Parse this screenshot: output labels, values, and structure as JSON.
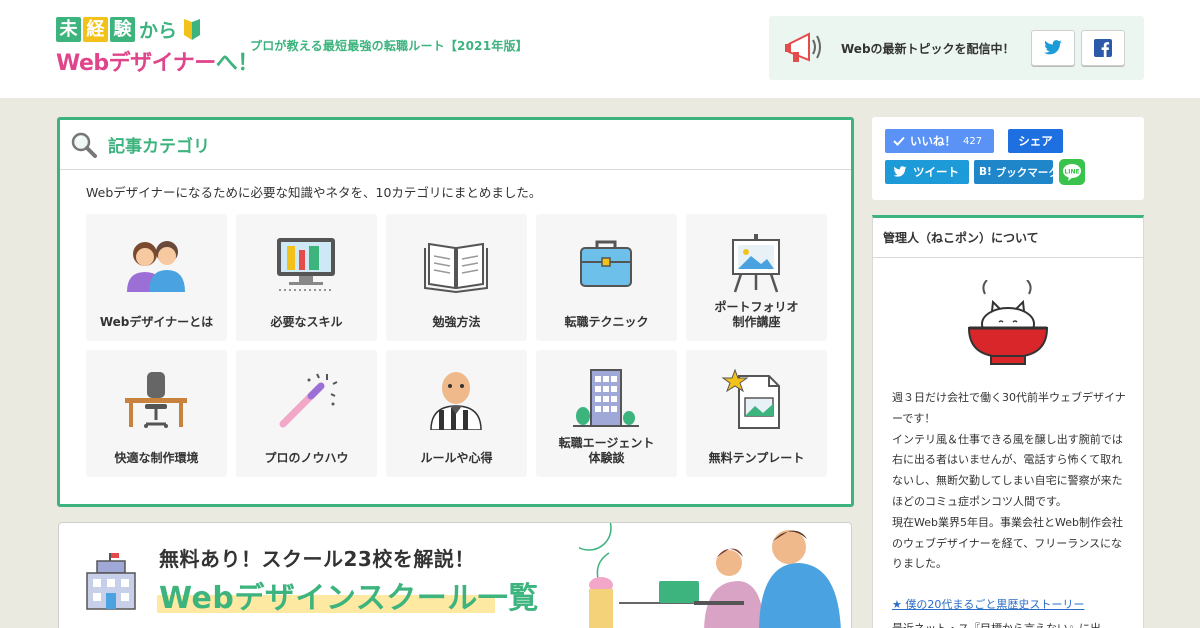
{
  "header": {
    "logo": {
      "chars": [
        "未",
        "経",
        "験"
      ],
      "kara": "から",
      "line2_main": "Webデザイナー",
      "line2_end": "へ！"
    },
    "tagline": "プロが教える最短最強の転職ルート【2021年版】",
    "subscribe_text": "Webの最新トピックを配信中！",
    "twitter_icon": "twitter-icon",
    "facebook_icon": "facebook-icon"
  },
  "categories": {
    "title": "記事カテゴリ",
    "description": "Webデザイナーになるために必要な知識やネタを、10カテゴリにまとめました。",
    "items": [
      {
        "label": "Webデザイナーとは",
        "icon": "people-icon"
      },
      {
        "label": "必要なスキル",
        "icon": "design-tools-icon"
      },
      {
        "label": "勉強方法",
        "icon": "book-icon"
      },
      {
        "label": "転職テクニック",
        "icon": "briefcase-icon"
      },
      {
        "label": "ポートフォリオ\n制作講座",
        "icon": "easel-icon"
      },
      {
        "label": "快適な制作環境",
        "icon": "desk-chair-icon"
      },
      {
        "label": "プロのノウハウ",
        "icon": "magic-wand-icon"
      },
      {
        "label": "ルールや心得",
        "icon": "referee-icon"
      },
      {
        "label": "転職エージェント\n体験談",
        "icon": "building-icon"
      },
      {
        "label": "無料テンプレート",
        "icon": "template-icon"
      }
    ]
  },
  "banner": {
    "subtitle": "無料あり！スクール23校を解説！",
    "title": "Webデザインスクール一覧"
  },
  "share": {
    "like_label": "いいね！",
    "like_count": "427",
    "share_label": "シェア",
    "tweet_label": "ツイート",
    "hatena_label": "ブックマーク",
    "hatena_badge": "B!",
    "line_label": "LINE"
  },
  "about": {
    "title": "管理人（ねこポン）について",
    "paragraph1": "週３日だけ会社で働く30代前半ウェブデザイナーです！",
    "paragraph2": "インテリ風＆仕事できる風を醸し出す腕前では右に出る者はいませんが、電話すら怖くて取れないし、無断欠勤してしまい自宅に警察が来たほどのコミュ症ポンコツ人間です。",
    "paragraph3": "現在Web業界5年目。事業会社とWeb制作会社のウェブデザイナーを経て、フリーランスになりました。",
    "link": "★ 僕の20代まるごと黒歴史ストーリー",
    "cut_line": "最近ネット・ス『目標から言えない』に出"
  },
  "colors": {
    "accent_green": "#3db37e",
    "logo_pink": "#e0458c",
    "background": "#ebeae0"
  }
}
